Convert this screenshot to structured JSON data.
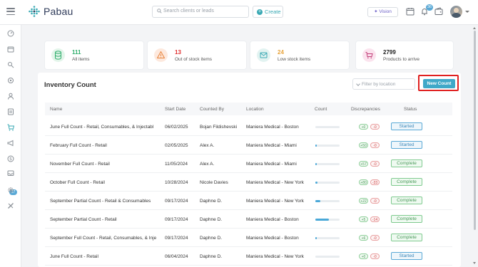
{
  "header": {
    "app_name": "Pabau",
    "search_placeholder": "Search clients or leads",
    "create_label": "Create",
    "vision_label": "Vision",
    "notification_count": "36"
  },
  "sidebar": {
    "icons": [
      "dashboard-icon",
      "calendar-icon",
      "clients-icon",
      "leads-icon",
      "user-icon",
      "reports-icon",
      "cart-icon",
      "marketing-icon",
      "financial-icon",
      "inbox-icon",
      "settings-icon",
      "tools-icon"
    ],
    "inbox_badge": "17"
  },
  "stats": [
    {
      "value": "111",
      "label": "All items",
      "color": "#2eae6b",
      "bg": "#e3f5ea",
      "icon": "database-icon"
    },
    {
      "value": "13",
      "label": "Out of stock items",
      "color": "#e03030",
      "bg": "#fde9de",
      "icon": "warning-icon"
    },
    {
      "value": "24",
      "label": "Low stock items",
      "color": "#e8a33a",
      "bg": "#e2f3f1",
      "icon": "mail-icon"
    },
    {
      "value": "2799",
      "label": "Products to arrive",
      "color": "#222222",
      "bg": "#fbe3ee",
      "icon": "cart-arrow-icon"
    }
  ],
  "inventory": {
    "title": "Inventory Count",
    "filter_placeholder": "Filter by location",
    "new_count_label": "New Count",
    "columns": [
      "Name",
      "Start Date",
      "Counted By",
      "Location",
      "Count",
      "Discrepancies",
      "Status"
    ],
    "rows": [
      {
        "name": "June Full Count - Retail, Consumables, & Injectabl",
        "date": "06/02/2025",
        "by": "Bojan Fildishevski",
        "location": "Maniera Medical - Boston",
        "progress": 0,
        "pos": "+0",
        "neg": "-0",
        "status": "Started",
        "status_type": "started"
      },
      {
        "name": "February Full Count - Retail",
        "date": "02/05/2025",
        "by": "Alex A.",
        "location": "Maniera Medical - Miami",
        "progress": 0.03,
        "pos": "+50",
        "neg": "-0",
        "status": "Started",
        "status_type": "started"
      },
      {
        "name": "November Full Count - Retail",
        "date": "11/05/2024",
        "by": "Alex A.",
        "location": "Maniera Medical - Miami",
        "progress": 0.03,
        "pos": "+57",
        "neg": "-0",
        "status": "Complete",
        "status_type": "complete"
      },
      {
        "name": "October Full Count - Retail",
        "date": "10/28/2024",
        "by": "Nicole Davies",
        "location": "Maniera Medical - New York",
        "progress": 0.1,
        "pos": "+80",
        "neg": "-33",
        "status": "Complete",
        "status_type": "complete"
      },
      {
        "name": "September Partial Count - Retail & Consumables",
        "date": "09/17/2024",
        "by": "Daphne D.",
        "location": "Maniera Medical - New York",
        "progress": 0.22,
        "pos": "+22",
        "neg": "-0",
        "status": "Complete",
        "status_type": "complete"
      },
      {
        "name": "September Partial Count - Retail",
        "date": "09/17/2024",
        "by": "Daphne D.",
        "location": "Maniera Medical - Boston",
        "progress": 0.55,
        "pos": "+5",
        "neg": "-14",
        "status": "Complete",
        "status_type": "complete"
      },
      {
        "name": "September Full Count - Retail, Consumables, & Inje",
        "date": "09/17/2024",
        "by": "Daphne D.",
        "location": "Maniera Medical - Boston",
        "progress": 0.03,
        "pos": "+6",
        "neg": "-0",
        "status": "Complete",
        "status_type": "complete"
      },
      {
        "name": "June Full Count - Retail",
        "date": "06/04/2024",
        "by": "Daphne D.",
        "location": "Maniera Medical - New York",
        "progress": 0,
        "pos": "+0",
        "neg": "-0",
        "status": "Started",
        "status_type": "started"
      }
    ]
  }
}
